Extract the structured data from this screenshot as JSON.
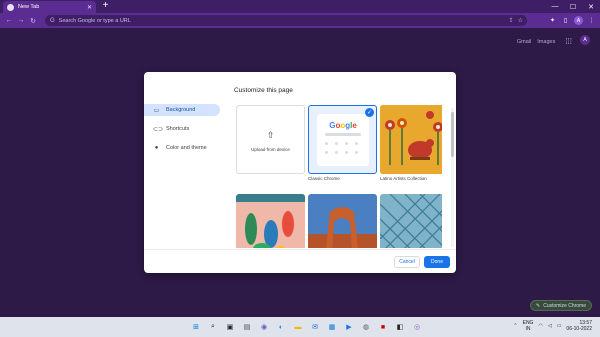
{
  "browser": {
    "tab_title": "New Tab",
    "tab_close": "✕",
    "new_tab": "+",
    "omnibox_placeholder": "Search Google or type a URL",
    "window": {
      "minimize": "—",
      "maximize": "☐",
      "close": "✕"
    },
    "profile_initial": "A"
  },
  "page": {
    "gmail": "Gmail",
    "images": "Images",
    "avatar_initial": "A",
    "customize_chip": "Customize Chrome"
  },
  "dialog": {
    "title": "Customize this page",
    "nav": [
      {
        "label": "Background",
        "icon": "background-icon"
      },
      {
        "label": "Shortcuts",
        "icon": "link-icon"
      },
      {
        "label": "Color and theme",
        "icon": "palette-icon"
      }
    ],
    "upload_label": "Upload from device",
    "tiles": [
      {
        "label": "Classic Chrome"
      },
      {
        "label": "Latino Artists Collection"
      }
    ],
    "google_logo": "Google",
    "cancel": "Cancel",
    "done": "Done"
  },
  "taskbar": {
    "lang_top": "ENG",
    "lang_bottom": "IN",
    "time": "13:57",
    "date": "06-10-2022"
  },
  "colors": {
    "accent": "#1a73e8",
    "frame": "#3e1f66",
    "toolbar": "#5b2d93",
    "page_bg": "#2d1a47"
  }
}
